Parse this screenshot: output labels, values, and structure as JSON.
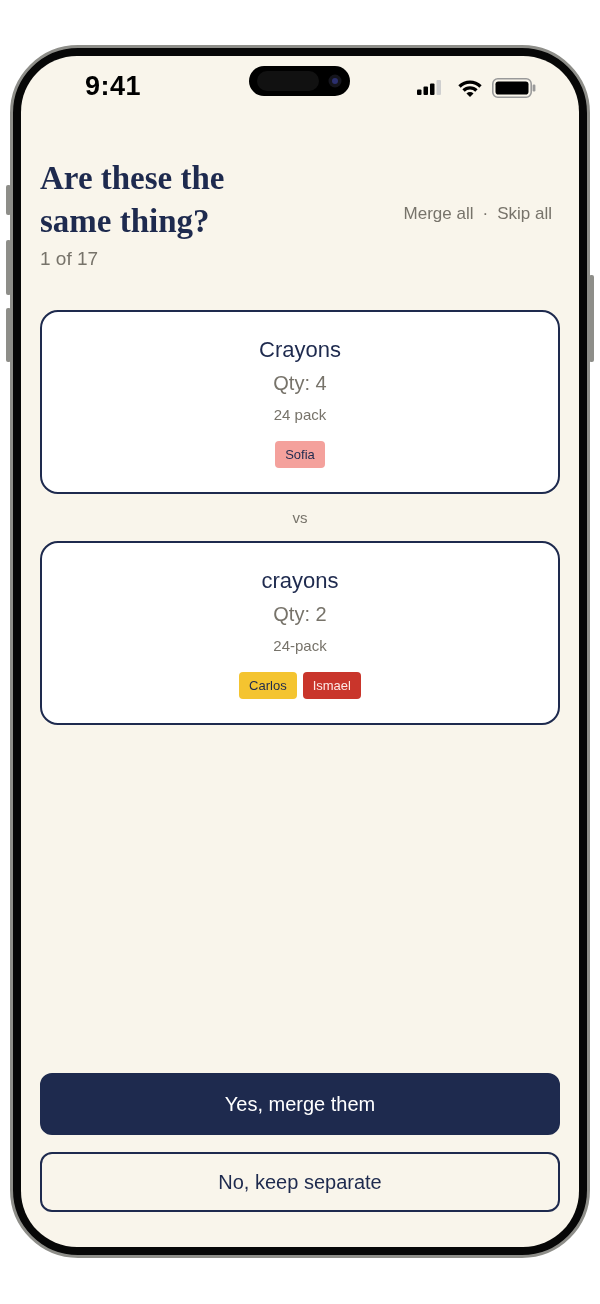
{
  "status_bar": {
    "time": "9:41"
  },
  "header": {
    "title": "Are these the same thing?",
    "progress": "1 of 17",
    "actions": [
      {
        "label": "Merge all"
      },
      {
        "label": "Skip all"
      }
    ],
    "separator": "·"
  },
  "items": [
    {
      "name": "Crayons",
      "quantity": "Qty: 4",
      "size": "24 pack",
      "tags": [
        {
          "label": "Sofia",
          "color": "#f4a19c"
        }
      ]
    },
    {
      "name": "crayons",
      "quantity": "Qty: 2",
      "size": "24-pack",
      "tags": [
        {
          "label": "Carlos",
          "color": "#f4c430"
        },
        {
          "label": "Ismael",
          "color": "#c9352b"
        }
      ]
    }
  ],
  "divider_label": "vs",
  "buttons": [
    {
      "label": "Yes, merge them",
      "kind": "primary"
    },
    {
      "label": "No, keep separate",
      "kind": "outline"
    }
  ]
}
